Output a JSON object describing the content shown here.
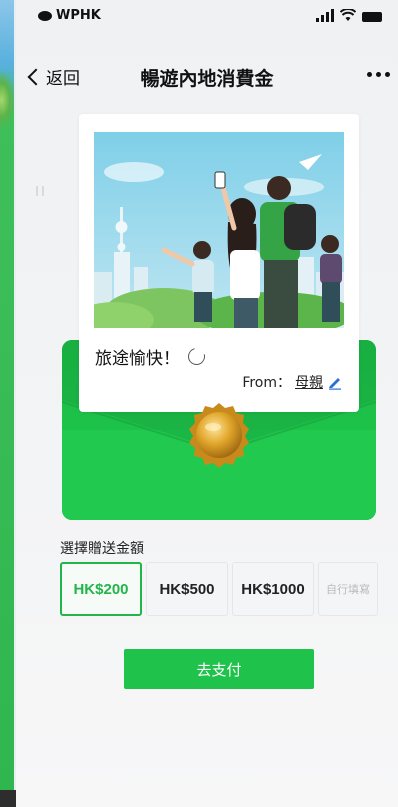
{
  "status_bar": {
    "carrier": "WPHK"
  },
  "nav": {
    "back_label": "返回",
    "title": "暢遊內地消費金"
  },
  "card": {
    "greeting": "旅途愉快！",
    "from_prefix": "From：",
    "from_name": "母親"
  },
  "amount": {
    "label": "選擇贈送金額",
    "options": [
      {
        "label": "HK$200",
        "selected": true
      },
      {
        "label": "HK$500",
        "selected": false
      },
      {
        "label": "HK$1000",
        "selected": false
      },
      {
        "label": "自行填寫",
        "selected": false
      }
    ]
  },
  "pay": {
    "label": "去支付"
  },
  "colors": {
    "accent": "#1fc24b",
    "envelope": "#1ec64a",
    "selected_border": "#21b54a"
  },
  "icons": [
    "back-chevron-icon",
    "more-icon",
    "refresh-icon",
    "edit-pencil-icon",
    "wax-seal-icon",
    "signal-icon",
    "wifi-icon",
    "battery-icon"
  ]
}
